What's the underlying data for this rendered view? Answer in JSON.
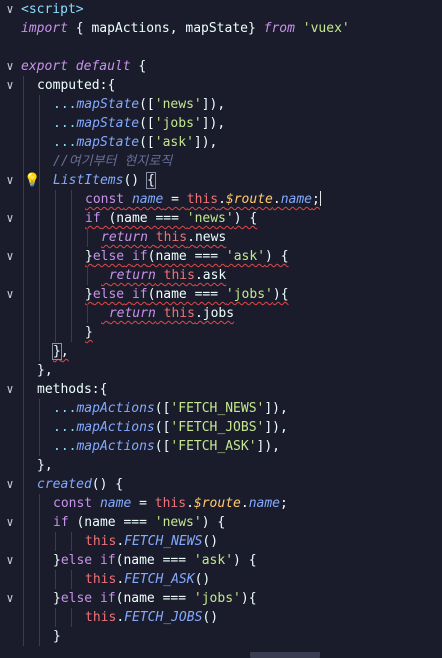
{
  "editor": {
    "lines": [
      {
        "fold": true,
        "indent": 0,
        "tokens": [
          [
            "tag",
            "<script>"
          ]
        ]
      },
      {
        "fold": false,
        "indent": 0,
        "tokens": [
          [
            "kw",
            "import"
          ],
          [
            "var",
            " { mapActions, mapState} "
          ],
          [
            "kw",
            "from"
          ],
          [
            "var",
            " "
          ],
          [
            "str",
            "'vuex'"
          ]
        ]
      },
      {
        "fold": false,
        "indent": 0,
        "tokens": []
      },
      {
        "fold": true,
        "indent": 0,
        "tokens": [
          [
            "kw",
            "export"
          ],
          [
            "var",
            " "
          ],
          [
            "kw",
            "default"
          ],
          [
            "var",
            " {"
          ]
        ]
      },
      {
        "fold": true,
        "indent": 1,
        "tokens": [
          [
            "var",
            "computed:{"
          ]
        ]
      },
      {
        "fold": false,
        "indent": 2,
        "tokens": [
          [
            "punc",
            "..."
          ],
          [
            "fn",
            "mapState"
          ],
          [
            "var",
            "(["
          ],
          [
            "str",
            "'news'"
          ],
          [
            "var",
            "]),"
          ]
        ]
      },
      {
        "fold": false,
        "indent": 2,
        "tokens": [
          [
            "punc",
            "..."
          ],
          [
            "fn",
            "mapState"
          ],
          [
            "var",
            "(["
          ],
          [
            "str",
            "'jobs'"
          ],
          [
            "var",
            "]),"
          ]
        ]
      },
      {
        "fold": false,
        "indent": 2,
        "tokens": [
          [
            "punc",
            "..."
          ],
          [
            "fn",
            "mapState"
          ],
          [
            "var",
            "(["
          ],
          [
            "str",
            "'ask'"
          ],
          [
            "var",
            "]),"
          ]
        ]
      },
      {
        "fold": false,
        "indent": 2,
        "tokens": [
          [
            "com",
            "//여기부터 현지로직"
          ]
        ]
      },
      {
        "fold": true,
        "indent": 2,
        "bulb": true,
        "tokens": [
          [
            "fn",
            "ListItems"
          ],
          [
            "var",
            "() "
          ],
          [
            "box",
            "{"
          ]
        ],
        "squiggle": false
      },
      {
        "fold": false,
        "indent": 4,
        "squiggle": true,
        "tokens": [
          [
            "kw2",
            "const"
          ],
          [
            "var",
            " "
          ],
          [
            "name",
            "name"
          ],
          [
            "var",
            " = "
          ],
          [
            "this",
            "this"
          ],
          [
            "var",
            "."
          ],
          [
            "route",
            "$route"
          ],
          [
            "var",
            "."
          ],
          [
            "name",
            "name"
          ],
          [
            "var",
            ";"
          ],
          [
            "cursor",
            ""
          ]
        ]
      },
      {
        "fold": true,
        "indent": 4,
        "squiggle": true,
        "tokens": [
          [
            "kw2",
            "if"
          ],
          [
            "var",
            " (name === "
          ],
          [
            "str",
            "'news'"
          ],
          [
            "var",
            ") {"
          ]
        ]
      },
      {
        "fold": false,
        "indent": 5,
        "squiggle": true,
        "tokens": [
          [
            "kw",
            "return"
          ],
          [
            "var",
            " "
          ],
          [
            "this",
            "this"
          ],
          [
            "var",
            "."
          ],
          [
            "var",
            "news"
          ]
        ]
      },
      {
        "fold": true,
        "indent": 4,
        "squiggle": true,
        "tokens": [
          [
            "var",
            "}"
          ],
          [
            "kw2",
            "else"
          ],
          [
            "var",
            " "
          ],
          [
            "kw2",
            "if"
          ],
          [
            "var",
            "(name === "
          ],
          [
            "str",
            "'ask'"
          ],
          [
            "var",
            ") {"
          ]
        ]
      },
      {
        "fold": false,
        "indent": 5,
        "squiggle": true,
        "tokens": [
          [
            "var",
            " "
          ],
          [
            "kw",
            "return"
          ],
          [
            "var",
            " "
          ],
          [
            "this",
            "this"
          ],
          [
            "var",
            ".ask"
          ]
        ]
      },
      {
        "fold": true,
        "indent": 4,
        "squiggle": true,
        "tokens": [
          [
            "var",
            "}"
          ],
          [
            "kw2",
            "else"
          ],
          [
            "var",
            " "
          ],
          [
            "kw2",
            "if"
          ],
          [
            "var",
            "(name === "
          ],
          [
            "str",
            "'jobs'"
          ],
          [
            "var",
            "){"
          ]
        ]
      },
      {
        "fold": false,
        "indent": 5,
        "squiggle": true,
        "tokens": [
          [
            "var",
            " "
          ],
          [
            "kw",
            "return"
          ],
          [
            "var",
            " "
          ],
          [
            "this",
            "this"
          ],
          [
            "var",
            ".jobs"
          ]
        ]
      },
      {
        "fold": false,
        "indent": 4,
        "squiggle": true,
        "tokens": [
          [
            "var",
            "}"
          ]
        ]
      },
      {
        "fold": false,
        "indent": 2,
        "squiggle": true,
        "tokens": [
          [
            "box",
            "}"
          ],
          [
            "var",
            ","
          ]
        ]
      },
      {
        "fold": false,
        "indent": 1,
        "tokens": [
          [
            "var",
            "},"
          ]
        ]
      },
      {
        "fold": true,
        "indent": 1,
        "tokens": [
          [
            "var",
            "methods:{"
          ]
        ]
      },
      {
        "fold": false,
        "indent": 2,
        "tokens": [
          [
            "punc",
            "..."
          ],
          [
            "fn",
            "mapActions"
          ],
          [
            "var",
            "(["
          ],
          [
            "str",
            "'FETCH_NEWS'"
          ],
          [
            "var",
            "]),"
          ]
        ]
      },
      {
        "fold": false,
        "indent": 2,
        "tokens": [
          [
            "punc",
            "..."
          ],
          [
            "fn",
            "mapActions"
          ],
          [
            "var",
            "(["
          ],
          [
            "str",
            "'FETCH_JOBS'"
          ],
          [
            "var",
            "]),"
          ]
        ]
      },
      {
        "fold": false,
        "indent": 2,
        "tokens": [
          [
            "punc",
            "..."
          ],
          [
            "fn",
            "mapActions"
          ],
          [
            "var",
            "(["
          ],
          [
            "str",
            "'FETCH_ASK'"
          ],
          [
            "var",
            "]),"
          ]
        ]
      },
      {
        "fold": false,
        "indent": 1,
        "tokens": [
          [
            "var",
            "},"
          ]
        ]
      },
      {
        "fold": true,
        "indent": 1,
        "tokens": [
          [
            "fn",
            "created"
          ],
          [
            "var",
            "() {"
          ]
        ]
      },
      {
        "fold": false,
        "indent": 2,
        "tokens": [
          [
            "kw2",
            "const"
          ],
          [
            "var",
            " "
          ],
          [
            "name",
            "name"
          ],
          [
            "var",
            " = "
          ],
          [
            "this",
            "this"
          ],
          [
            "var",
            "."
          ],
          [
            "route",
            "$route"
          ],
          [
            "var",
            "."
          ],
          [
            "name",
            "name"
          ],
          [
            "var",
            ";"
          ]
        ]
      },
      {
        "fold": true,
        "indent": 2,
        "tokens": [
          [
            "kw2",
            "if"
          ],
          [
            "var",
            " (name === "
          ],
          [
            "str",
            "'news'"
          ],
          [
            "var",
            ") {"
          ]
        ]
      },
      {
        "fold": false,
        "indent": 4,
        "tokens": [
          [
            "this",
            "this"
          ],
          [
            "var",
            "."
          ],
          [
            "fn",
            "FETCH_NEWS"
          ],
          [
            "var",
            "()"
          ]
        ]
      },
      {
        "fold": true,
        "indent": 2,
        "tokens": [
          [
            "var",
            "}"
          ],
          [
            "kw2",
            "else"
          ],
          [
            "var",
            " "
          ],
          [
            "kw2",
            "if"
          ],
          [
            "var",
            "(name === "
          ],
          [
            "str",
            "'ask'"
          ],
          [
            "var",
            ") {"
          ]
        ]
      },
      {
        "fold": false,
        "indent": 4,
        "tokens": [
          [
            "this",
            "this"
          ],
          [
            "var",
            "."
          ],
          [
            "fn",
            "FETCH_ASK"
          ],
          [
            "var",
            "()"
          ]
        ]
      },
      {
        "fold": true,
        "indent": 2,
        "tokens": [
          [
            "var",
            "}"
          ],
          [
            "kw2",
            "else"
          ],
          [
            "var",
            " "
          ],
          [
            "kw2",
            "if"
          ],
          [
            "var",
            "(name === "
          ],
          [
            "str",
            "'jobs'"
          ],
          [
            "var",
            "){"
          ]
        ]
      },
      {
        "fold": false,
        "indent": 4,
        "tokens": [
          [
            "this",
            "this"
          ],
          [
            "var",
            "."
          ],
          [
            "fn",
            "FETCH_JOBS"
          ],
          [
            "var",
            "()"
          ]
        ]
      },
      {
        "fold": false,
        "indent": 2,
        "tokens": [
          [
            "var",
            "}"
          ]
        ]
      }
    ]
  },
  "colors": {
    "background": "#1b1c2b",
    "keyword": "#c792ea",
    "string": "#c3e88d",
    "function": "#82aaff",
    "this": "#f07178",
    "comment": "#676e95",
    "squiggle": "#e04848"
  },
  "icons": {
    "fold_open": "chevron-down-icon",
    "lightbulb": "lightbulb-icon"
  }
}
